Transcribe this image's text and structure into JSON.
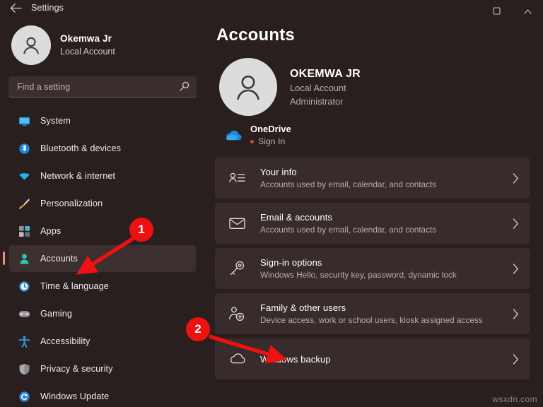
{
  "titlebar": {
    "back_label": "←",
    "title": "Settings",
    "minimize_label": "—",
    "maximize_label": "☐",
    "close_label": "✕"
  },
  "sidebar": {
    "account": {
      "name": "Okemwa Jr",
      "subtitle": "Local Account",
      "avatar_icon": "person-avatar-icon"
    },
    "search": {
      "placeholder": "Find a setting",
      "icon": "search-icon"
    },
    "items": [
      {
        "label": "System",
        "icon": "monitor-icon",
        "selected": false
      },
      {
        "label": "Bluetooth & devices",
        "icon": "bluetooth-icon",
        "selected": false
      },
      {
        "label": "Network & internet",
        "icon": "wifi-icon",
        "selected": false
      },
      {
        "label": "Personalization",
        "icon": "paintbrush-icon",
        "selected": false
      },
      {
        "label": "Apps",
        "icon": "apps-grid-icon",
        "selected": false
      },
      {
        "label": "Accounts",
        "icon": "person-icon",
        "selected": true
      },
      {
        "label": "Time & language",
        "icon": "clock-icon",
        "selected": false
      },
      {
        "label": "Gaming",
        "icon": "gamepad-icon",
        "selected": false
      },
      {
        "label": "Accessibility",
        "icon": "accessibility-icon",
        "selected": false
      },
      {
        "label": "Privacy & security",
        "icon": "shield-icon",
        "selected": false
      },
      {
        "label": "Windows Update",
        "icon": "refresh-icon",
        "selected": false
      }
    ]
  },
  "main": {
    "page_title": "Accounts",
    "profile": {
      "name": "OKEMWA JR",
      "line1": "Local Account",
      "line2": "Administrator",
      "avatar_icon": "person-avatar-icon"
    },
    "onedrive": {
      "title": "OneDrive",
      "status": "Sign In",
      "icon": "onedrive-cloud-icon",
      "status_dot_color": "#d04a3a"
    },
    "cards": [
      {
        "title": "Your info",
        "desc": "Accounts used by email, calendar, and contacts",
        "icon": "your-info-icon",
        "chevron": "›"
      },
      {
        "title": "Email & accounts",
        "desc": "Accounts used by email, calendar, and contacts",
        "icon": "envelope-icon",
        "chevron": "›"
      },
      {
        "title": "Sign-in options",
        "desc": "Windows Hello, security key, password, dynamic lock",
        "icon": "key-icon",
        "chevron": "›"
      },
      {
        "title": "Family & other users",
        "desc": "Device access, work or school users, kiosk assigned access",
        "icon": "add-user-icon",
        "chevron": "›"
      },
      {
        "title": "Windows backup",
        "desc": "",
        "icon": "backup-icon",
        "chevron": "›"
      }
    ]
  },
  "annotations": {
    "color": "#ee1111",
    "markers": [
      {
        "number": "1",
        "target": "sidebar-item-accounts"
      },
      {
        "number": "2",
        "target": "card-family-other-users"
      }
    ]
  },
  "watermark": {
    "text": "wsxdn.com"
  },
  "colors": {
    "page_background": "#2a1f1f",
    "card_background": "#372b2b",
    "selected_accent": "#f08a78",
    "text_primary": "#ffffff",
    "text_secondary": "#b6adad"
  }
}
